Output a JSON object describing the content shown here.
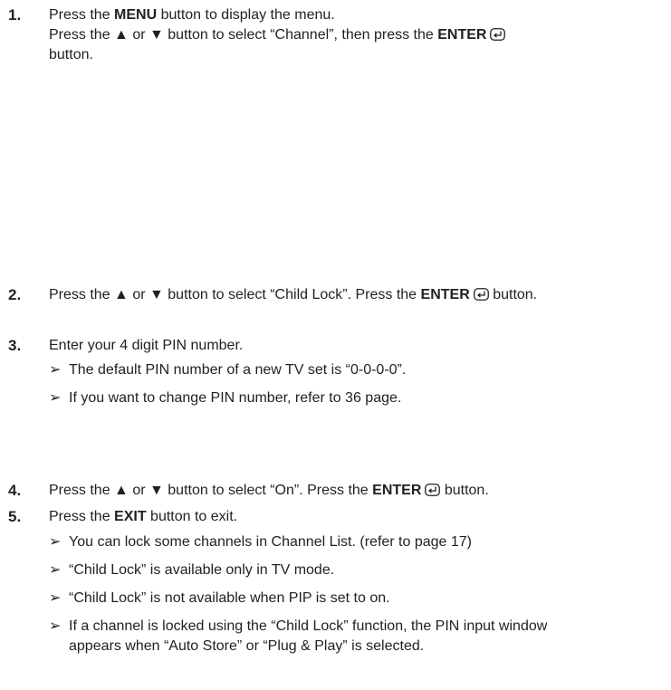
{
  "steps": [
    {
      "number": "1.",
      "lines": [
        {
          "pre": "Press the ",
          "bold": "MENU",
          "post": " button to display the menu."
        },
        {
          "pre": "Press the ▲ or ▼ button to select “Channel”, then press the ",
          "bold": "ENTER",
          "post": ""
        },
        {
          "text": "button."
        }
      ]
    },
    {
      "number": "2.",
      "pre": "Press the ▲ or ▼ button to select “Child Lock”. Press the ",
      "bold": "ENTER",
      "post": " button."
    },
    {
      "number": "3.",
      "text": "Enter your 4 digit PIN number.",
      "notes": [
        "The default PIN number of a new TV set is “0-0-0-0”.",
        "If you want to change PIN number, refer to 36 page."
      ]
    },
    {
      "number": "4.",
      "pre": "Press the ▲ or ▼ button to select “On”. Press the ",
      "bold": "ENTER",
      "post": " button."
    },
    {
      "number": "5.",
      "pre": "Press the ",
      "bold": "EXIT",
      "post": " button to exit.",
      "notes": [
        "You can lock some channels in Channel List. (refer to page 17)",
        "“Child Lock” is available only in TV mode.",
        "“Child Lock” is not available when PIP is set to on.",
        "If a channel is locked using the “Child Lock” function, the PIN input window appears when “Auto Store” or “Plug & Play” is selected."
      ]
    }
  ],
  "note_arrow": "➢",
  "icons": {
    "enter": "enter-icon"
  }
}
